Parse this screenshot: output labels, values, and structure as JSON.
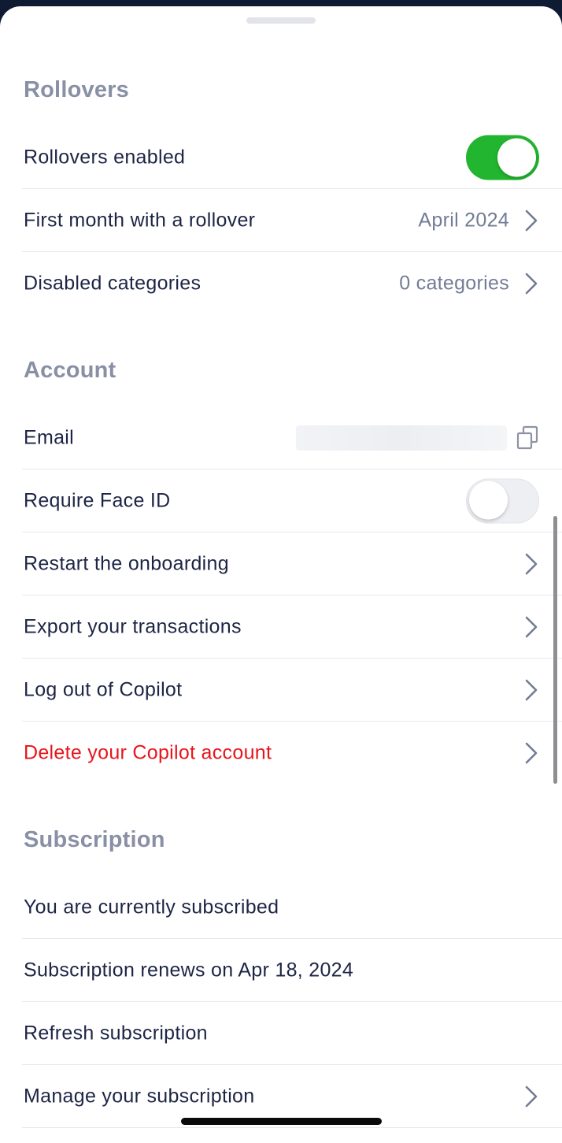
{
  "sections": {
    "rollovers": {
      "title": "Rollovers",
      "enabled_label": "Rollovers enabled",
      "enabled_state": true,
      "first_month_label": "First month with a rollover",
      "first_month_value": "April 2024",
      "disabled_label": "Disabled categories",
      "disabled_value": "0 categories"
    },
    "account": {
      "title": "Account",
      "email_label": "Email",
      "face_id_label": "Require Face ID",
      "face_id_state": false,
      "restart_label": "Restart the onboarding",
      "export_label": "Export your transactions",
      "logout_label": "Log out of Copilot",
      "delete_label": "Delete your Copilot account"
    },
    "subscription": {
      "title": "Subscription",
      "status_label": "You are currently subscribed",
      "renews_label": "Subscription renews on Apr 18, 2024",
      "refresh_label": "Refresh subscription",
      "manage_label": "Manage your subscription"
    }
  },
  "colors": {
    "toggle_on": "#22b52f",
    "danger": "#e8141c",
    "text": "#1d2545",
    "section_title": "#8990a6",
    "secondary": "#737c96"
  },
  "icons": {
    "chevron": "chevron-right-icon",
    "copy": "copy-icon"
  }
}
